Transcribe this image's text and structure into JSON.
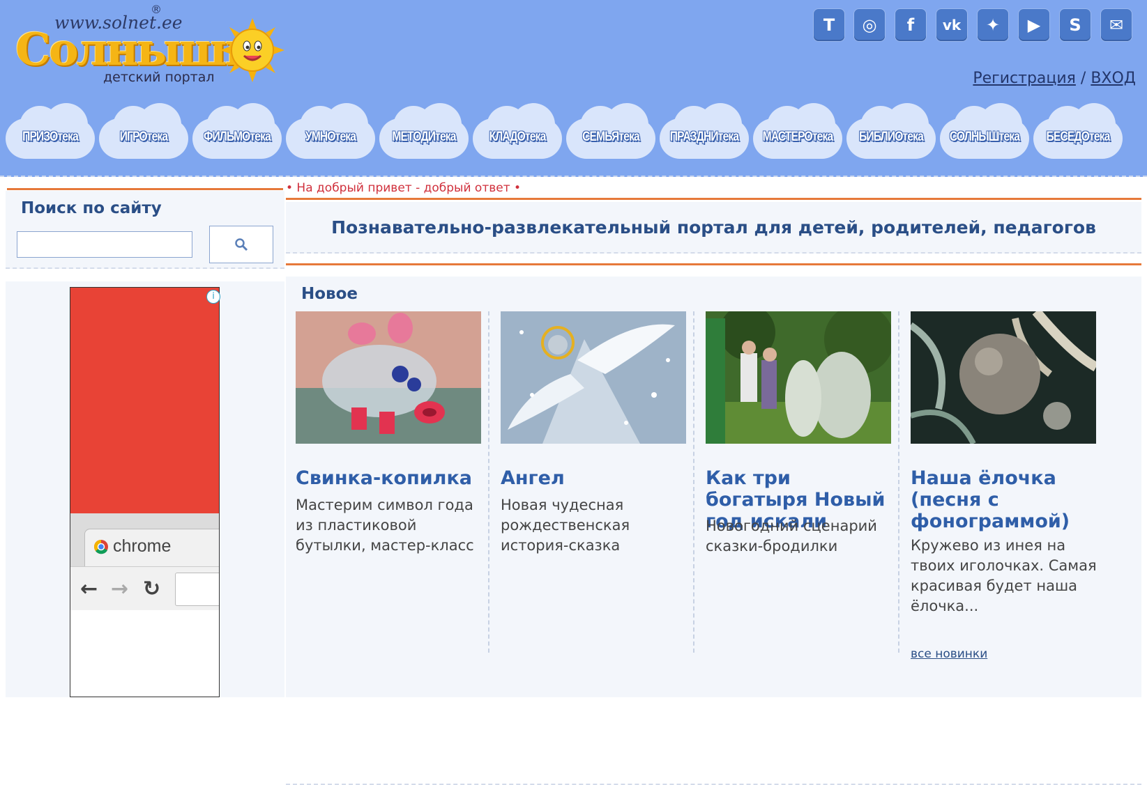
{
  "header": {
    "logo_url": "www.solnet.ee",
    "logo_reg": "®",
    "logo_text": "Солнышк",
    "logo_subtitle": "детский портал",
    "social": [
      {
        "icon": "cyrillic-t-icon",
        "glyph": "Т"
      },
      {
        "icon": "instagram-icon",
        "glyph": "◎"
      },
      {
        "icon": "facebook-icon",
        "glyph": "f"
      },
      {
        "icon": "vk-icon",
        "glyph": "vk"
      },
      {
        "icon": "twitter-icon",
        "glyph": "✦"
      },
      {
        "icon": "youtube-icon",
        "glyph": "▶"
      },
      {
        "icon": "skype-icon",
        "glyph": "S"
      },
      {
        "icon": "mail-icon",
        "glyph": "✉"
      }
    ],
    "register_label": "Регистрация",
    "auth_separator": "/",
    "login_label": "ВХОД"
  },
  "nav": [
    "ПРИЗОтека",
    "ИГРОтека",
    "ФИЛЬМОтека",
    "УМНОтека",
    "МЕТОДИтека",
    "КЛАДОтека",
    "СЕМЬЯтека",
    "ПРАЗДНИтека",
    "МАСТЕРОтека",
    "БИБЛИОтека",
    "СОЛНЫШтека",
    "БЕСЕДОтека"
  ],
  "sidebar": {
    "search_title": "Поиск по сайту",
    "search_placeholder": "",
    "ad_tab_label": "chrome",
    "ad_info": "i"
  },
  "main": {
    "greeting": "• На добрый привет - добрый ответ •",
    "portal_description": "Познавательно-развлекательный портал для детей, родителей, педагогов",
    "news_heading": "Новое",
    "cards": [
      {
        "title": "Свинка-копилка",
        "desc": "Мастерим символ года из пластиковой бутылки, мастер-класс"
      },
      {
        "title": "Ангел",
        "desc": "Новая чудесная рождественская история-сказка"
      },
      {
        "title": "Как три богатыря Новый год искали",
        "desc": "Новогодний сценарий сказки-бродилки"
      },
      {
        "title": "Наша ёлочка (песня с фонограммой)",
        "desc": "Кружево из инея на твоих иголочках. Самая красивая будет наша ёлочка..."
      }
    ],
    "all_news_label": "все новинки"
  },
  "colors": {
    "header_bg": "#7fa6ef",
    "accent_orange": "#e6793a",
    "title_blue": "#2a4e86",
    "greeting_red": "#d0303c"
  }
}
